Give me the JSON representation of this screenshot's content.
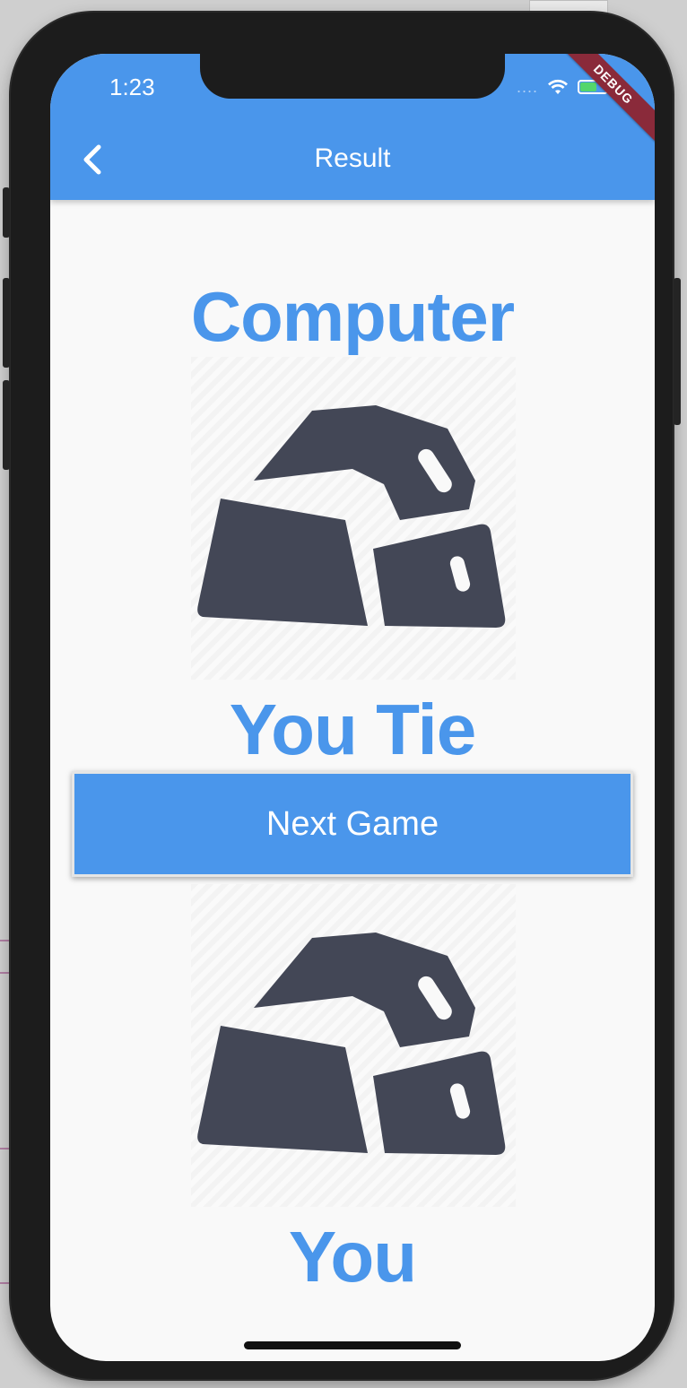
{
  "status_bar": {
    "time": "1:23",
    "signal": "....",
    "debug_label": "DEBUG"
  },
  "app_bar": {
    "title": "Result",
    "back_icon": "chevron-left-icon"
  },
  "result": {
    "computer_label": "Computer",
    "outcome": "You Tie",
    "next_button_label": "Next Game",
    "player_label": "You",
    "computer_choice_icon": "rock-icon",
    "player_choice_icon": "rock-icon"
  },
  "colors": {
    "primary": "#4a96eb",
    "rock": "#434756",
    "background": "#f9f9f9",
    "debug_ribbon": "#8a2a3a"
  }
}
